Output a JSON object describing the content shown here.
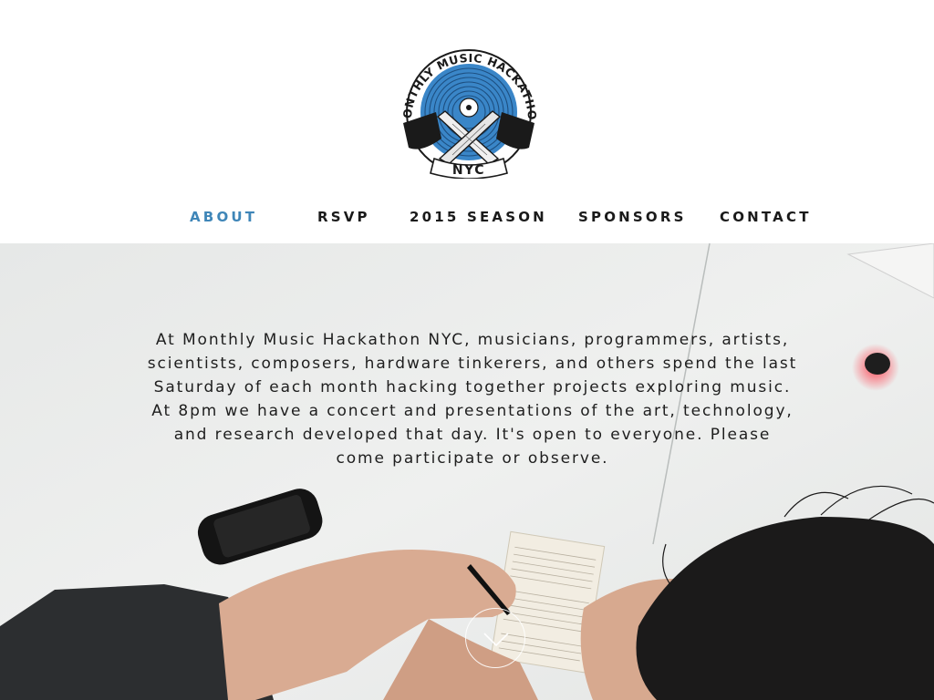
{
  "logo": {
    "top_text": "MONTHLY MUSIC HACKATHON",
    "banner_text": "NYC",
    "accent_color": "#3a86c8"
  },
  "nav": {
    "items": [
      {
        "label": "ABOUT",
        "active": true
      },
      {
        "label": "RSVP",
        "active": false
      },
      {
        "label": "2015 SEASON",
        "active": false
      },
      {
        "label": "SPONSORS",
        "active": false
      },
      {
        "label": "CONTACT",
        "active": false
      }
    ],
    "active_color": "#3f86b8"
  },
  "hero": {
    "intro_text": "At Monthly Music Hackathon NYC, musicians, programmers, artists, scientists, composers, hardware tinkerers, and others spend the last Saturday of each month hacking together projects exploring music. At 8pm we have a concert and presentations of the art, technology, and research developed that day. It's open to everyone. Please come participate or observe.",
    "scroll_icon": "chevron-down-icon"
  }
}
